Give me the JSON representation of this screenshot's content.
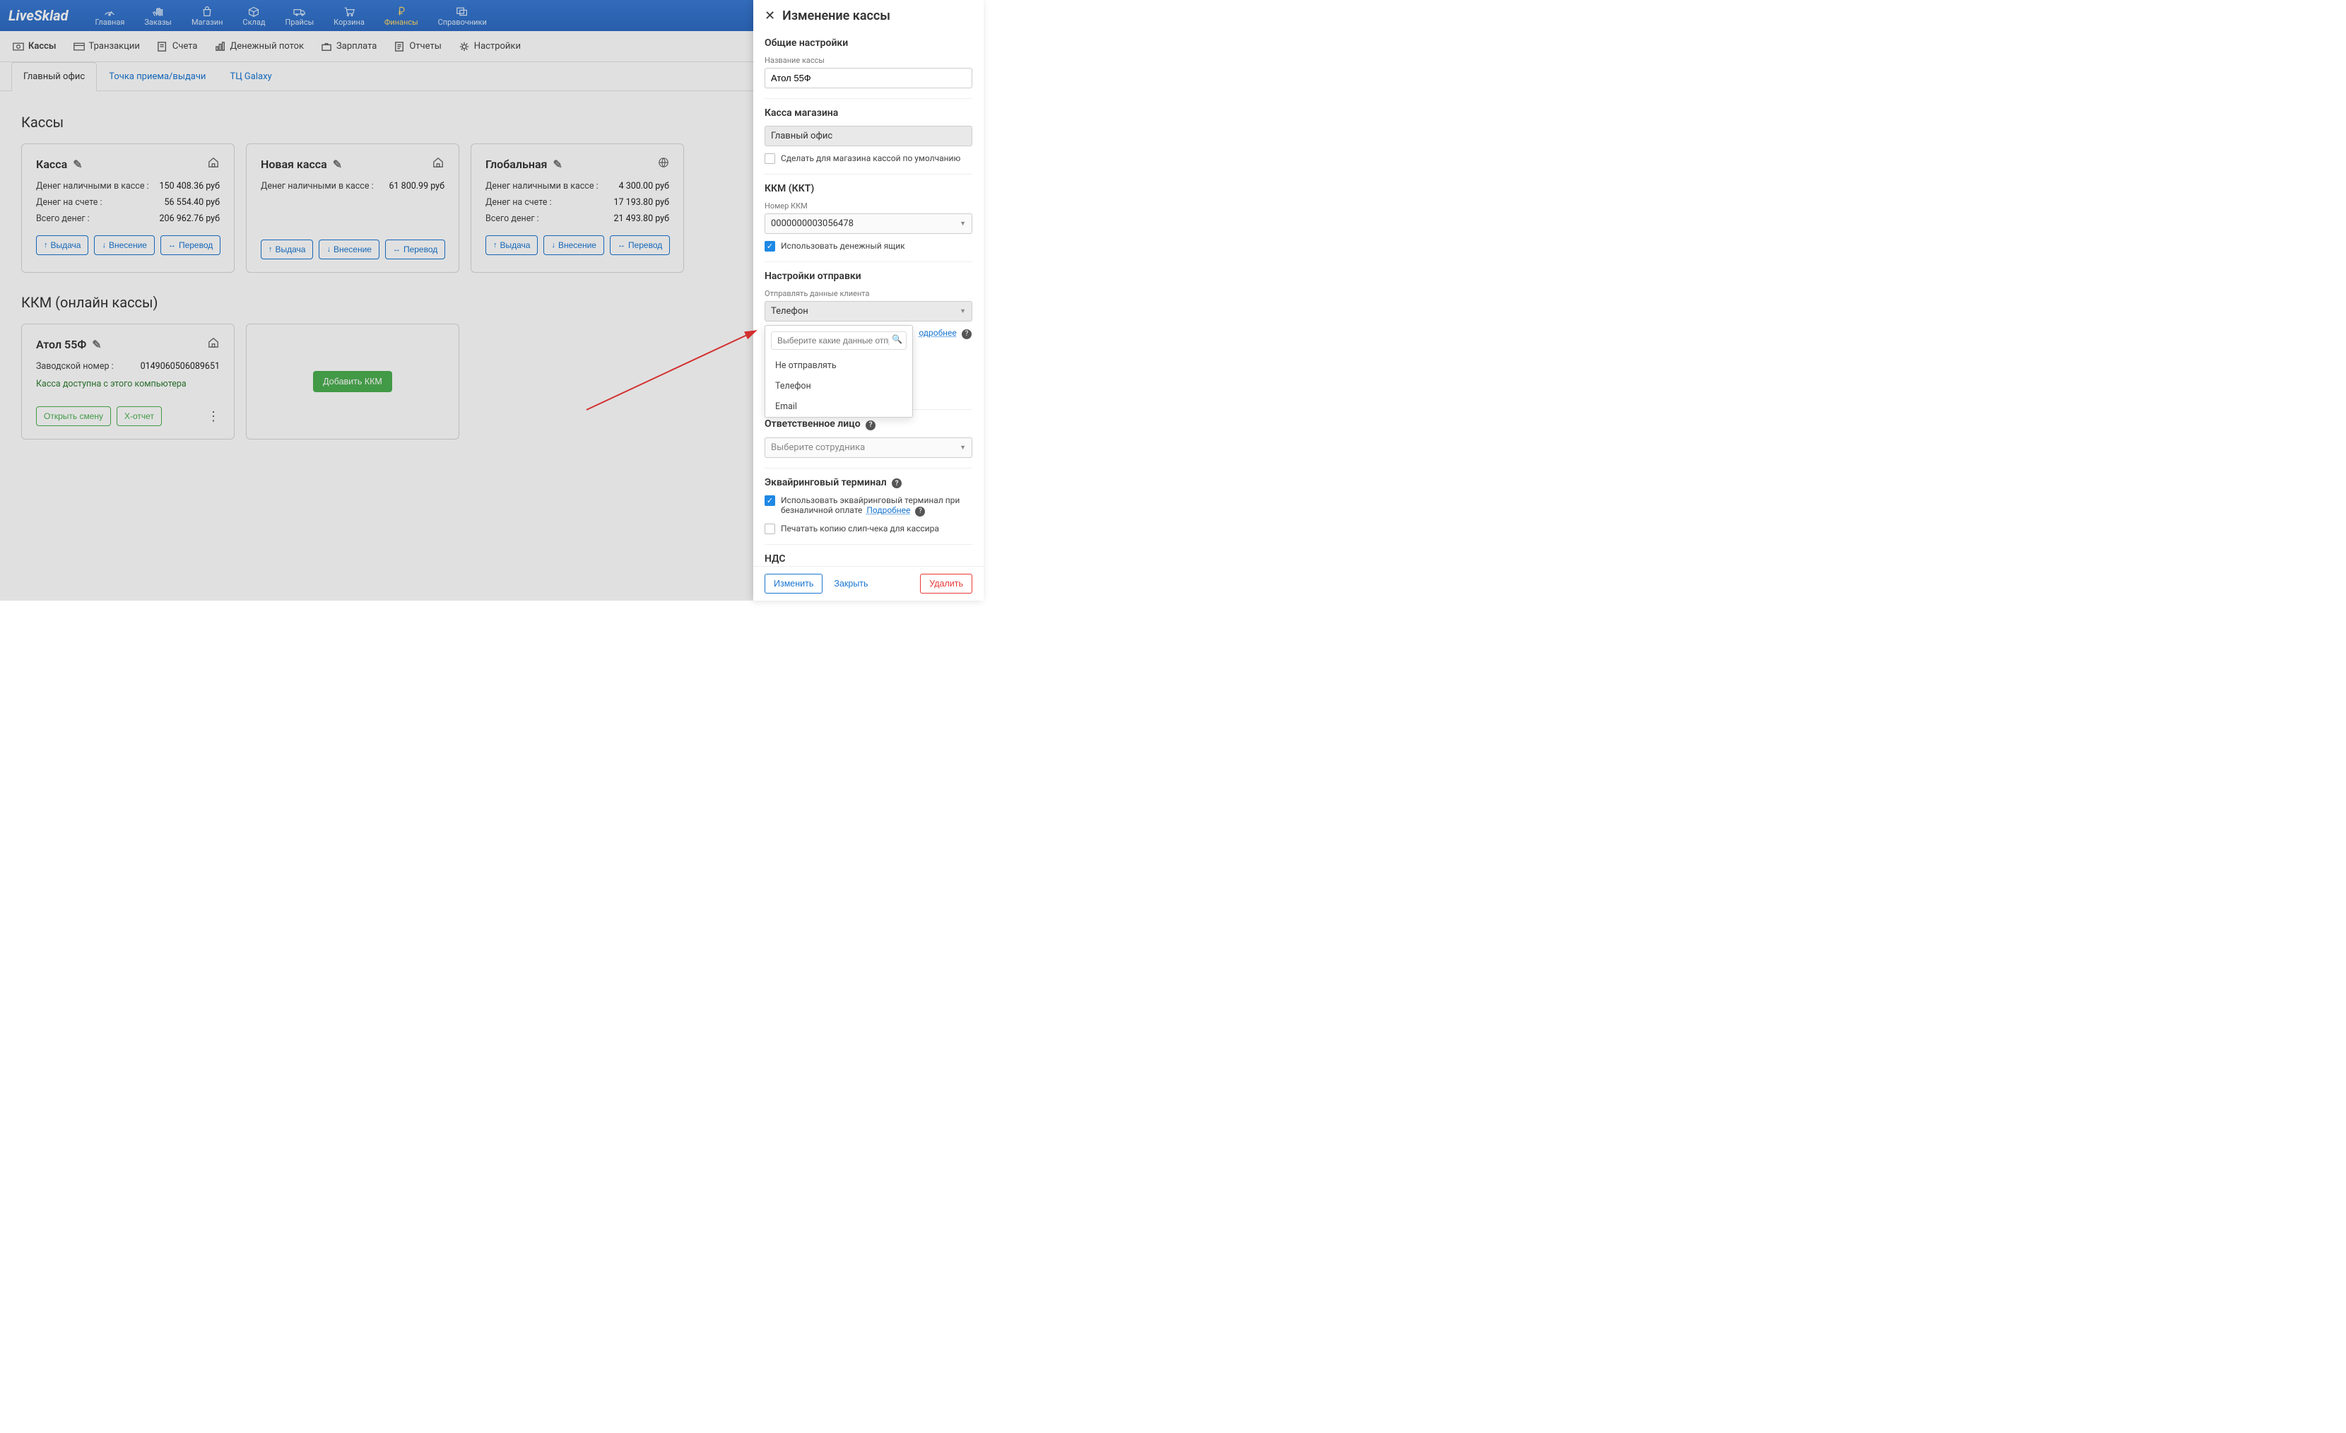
{
  "logo": "LiveSklad",
  "topnav": [
    {
      "label": "Главная"
    },
    {
      "label": "Заказы"
    },
    {
      "label": "Магазин"
    },
    {
      "label": "Склад"
    },
    {
      "label": "Прайсы"
    },
    {
      "label": "Корзина"
    },
    {
      "label": "Финансы",
      "active": true
    },
    {
      "label": "Справочники"
    }
  ],
  "subnav": [
    {
      "label": "Кассы",
      "active": true
    },
    {
      "label": "Транзакции"
    },
    {
      "label": "Счета"
    },
    {
      "label": "Денежный поток"
    },
    {
      "label": "Зарплата"
    },
    {
      "label": "Отчеты"
    },
    {
      "label": "Настройки"
    }
  ],
  "tabs": [
    {
      "label": "Главный офис",
      "active": true
    },
    {
      "label": "Точка приема/выдачи"
    },
    {
      "label": "ТЦ Galaxy"
    }
  ],
  "sections": {
    "kassy_title": "Кассы",
    "kkm_title": "ККМ (онлайн кассы)"
  },
  "cash_cards": [
    {
      "title": "Касса",
      "icon": "house",
      "rows": [
        {
          "k": "Денег наличными в кассе :",
          "v": "150 408.36 руб"
        },
        {
          "k": "Денег на счете :",
          "v": "56 554.40 руб"
        },
        {
          "k": "Всего денег :",
          "v": "206 962.76 руб"
        }
      ]
    },
    {
      "title": "Новая касса",
      "icon": "house",
      "rows": [
        {
          "k": "Денег наличными в кассе :",
          "v": "61 800.99 руб"
        }
      ]
    },
    {
      "title": "Глобальная",
      "icon": "globe",
      "rows": [
        {
          "k": "Денег наличными в кассе :",
          "v": "4 300.00 руб"
        },
        {
          "k": "Денег на счете :",
          "v": "17 193.80 руб"
        },
        {
          "k": "Всего денег :",
          "v": "21 493.80 руб"
        }
      ]
    }
  ],
  "card_actions": {
    "withdraw": "Выдача",
    "deposit": "Внесение",
    "transfer": "Перевод"
  },
  "kkm_card": {
    "title": "Атол 55Ф",
    "serial_label": "Заводской номер :",
    "serial_value": "0149060506089651",
    "status": "Касса доступна с этого компьютера",
    "open_shift": "Открыть смену",
    "x_report": "Х-отчет",
    "add_button": "Добавить ККМ"
  },
  "panel": {
    "title": "Изменение кассы",
    "general": "Общие настройки",
    "name_label": "Название кассы",
    "name_value": "Атол 55Ф",
    "store_section": "Касса магазина",
    "store_value": "Главный офис",
    "default_checkbox": "Сделать для магазина кассой по умолчанию",
    "kkm_section": "ККМ (ККТ)",
    "kkm_num_label": "Номер ККМ",
    "kkm_num_value": "0000000003056478",
    "drawer_checkbox": "Использовать денежный ящик",
    "send_section": "Настройки отправки",
    "send_label": "Отправлять данные клиента",
    "send_value": "Телефон",
    "send_search_placeholder": "Выберите какие данные отпр",
    "send_options": [
      "Не отправлять",
      "Телефон",
      "Email"
    ],
    "more_link": "одробнее",
    "responsible_section": "Ответственное лицо",
    "responsible_placeholder": "Выберите сотрудника",
    "acquiring_section": "Эквайринговый терминал",
    "acquiring_checkbox": "Использовать эквайринговый терминал при безналичной оплате",
    "acquiring_link": "Подробнее",
    "slip_checkbox": "Печатать копию слип-чека для кассира",
    "vat_section": "НДС",
    "footer": {
      "save": "Изменить",
      "close": "Закрыть",
      "delete": "Удалить"
    }
  }
}
